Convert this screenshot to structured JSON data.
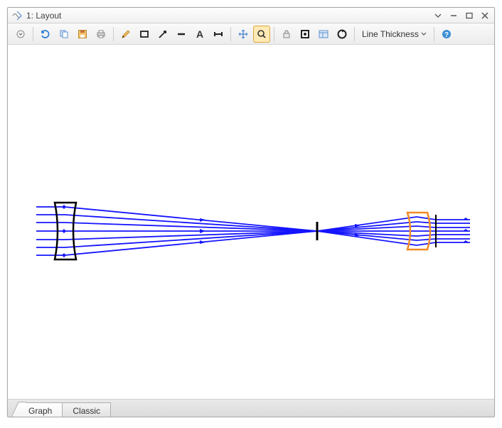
{
  "window": {
    "title": "1: Layout"
  },
  "toolbar": {
    "line_thickness_label": "Line Thickness"
  },
  "tabs": {
    "graph": "Graph",
    "classic": "Classic"
  }
}
